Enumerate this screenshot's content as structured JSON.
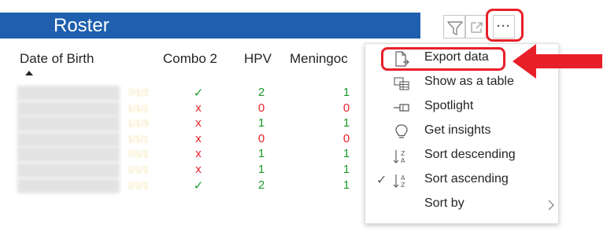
{
  "visual": {
    "title": "Roster",
    "header_bg": "#1f5fae"
  },
  "header_icons": {
    "filter": "filter-icon",
    "focus": "focus-mode-icon",
    "more": "more-options-icon"
  },
  "table": {
    "columns": [
      "Date of Birth",
      "Combo 2",
      "HPV",
      "Meningoc"
    ],
    "sort_column": "Date of Birth",
    "sort_direction": "ascending",
    "rows": [
      {
        "dob": "",
        "date": "7/1/2",
        "combo2": "✓",
        "combo2_status": "ok",
        "hpv": "2",
        "men": "1"
      },
      {
        "dob": "",
        "date": "1/1/1",
        "combo2": "x",
        "combo2_status": "missing",
        "hpv": "0",
        "men": "0"
      },
      {
        "dob": "",
        "date": "1/1/3",
        "combo2": "x",
        "combo2_status": "missing",
        "hpv": "1",
        "men": "1"
      },
      {
        "dob": "",
        "date": "1/1/1",
        "combo2": "x",
        "combo2_status": "missing",
        "hpv": "0",
        "men": "0"
      },
      {
        "dob": "",
        "date": "7/1/1",
        "combo2": "x",
        "combo2_status": "missing",
        "hpv": "1",
        "men": "1"
      },
      {
        "dob": "",
        "date": "1/1/1",
        "combo2": "x",
        "combo2_status": "missing",
        "hpv": "1",
        "men": "1"
      },
      {
        "dob": "",
        "date": "1/1/1",
        "combo2": "✓",
        "combo2_status": "ok",
        "hpv": "2",
        "men": "1"
      }
    ]
  },
  "context_menu": {
    "items": [
      {
        "label": "Export data",
        "icon": "export-data-icon",
        "checked": false,
        "submenu": false
      },
      {
        "label": "Show as a table",
        "icon": "show-as-table-icon",
        "checked": false,
        "submenu": false
      },
      {
        "label": "Spotlight",
        "icon": "spotlight-icon",
        "checked": false,
        "submenu": false
      },
      {
        "label": "Get insights",
        "icon": "lightbulb-icon",
        "checked": false,
        "submenu": false
      },
      {
        "label": "Sort descending",
        "icon": "sort-descending-icon",
        "checked": false,
        "submenu": false
      },
      {
        "label": "Sort ascending",
        "icon": "sort-ascending-icon",
        "checked": true,
        "submenu": false
      },
      {
        "label": "Sort by",
        "icon": "",
        "checked": false,
        "submenu": true
      }
    ]
  },
  "colors": {
    "accent_red": "#e8202a",
    "status_green": "#1c9a2a",
    "status_red": "#e8202a"
  }
}
